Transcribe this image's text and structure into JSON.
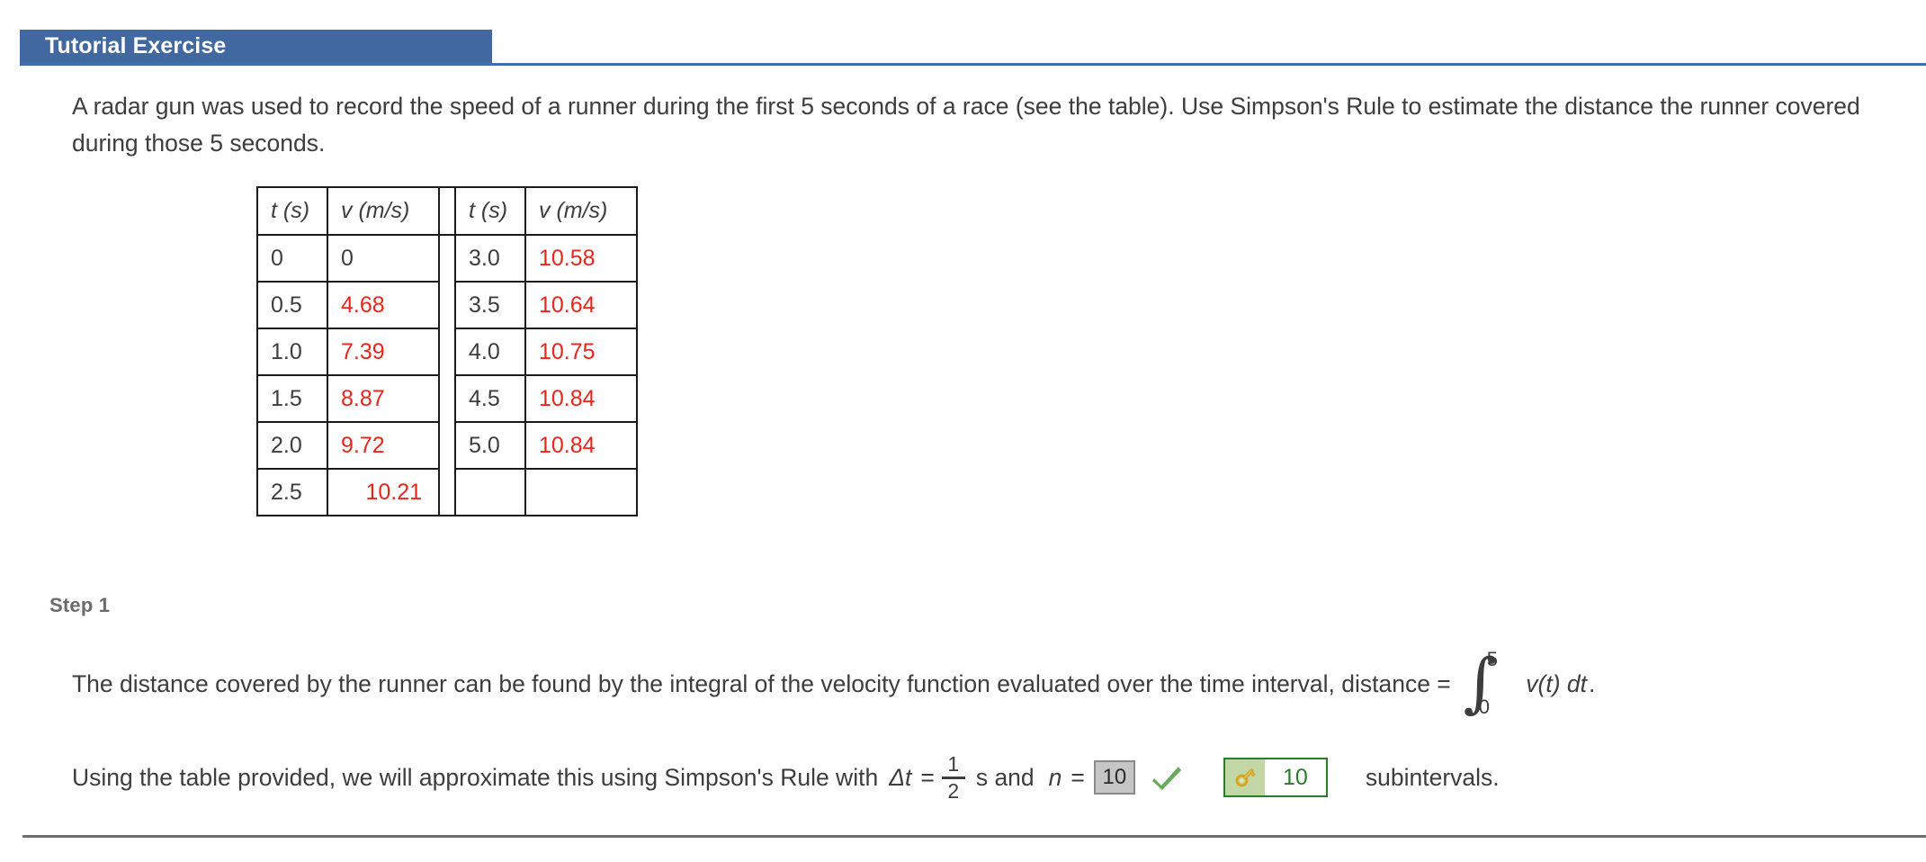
{
  "header": {
    "tab_label": "Tutorial Exercise",
    "tab_color": "#41699f",
    "rule_color": "#3f6fab"
  },
  "problem": {
    "statement": "A radar gun was used to record the speed of a runner during the first 5 seconds of a race (see the table). Use Simpson's Rule to estimate the distance the runner covered during those 5 seconds."
  },
  "data_table": {
    "headers": {
      "t": "t (s)",
      "v": "v (m/s)"
    },
    "left": [
      {
        "t": "0",
        "v": "0",
        "v_color": "dark"
      },
      {
        "t": "0.5",
        "v": "4.68",
        "v_color": "red"
      },
      {
        "t": "1.0",
        "v": "7.39",
        "v_color": "red"
      },
      {
        "t": "1.5",
        "v": "8.87",
        "v_color": "red"
      },
      {
        "t": "2.0",
        "v": "9.72",
        "v_color": "red"
      },
      {
        "t": "2.5",
        "v": "10.21",
        "v_color": "red"
      }
    ],
    "right": [
      {
        "t": "3.0",
        "v": "10.58",
        "v_color": "red"
      },
      {
        "t": "3.5",
        "v": "10.64",
        "v_color": "red"
      },
      {
        "t": "4.0",
        "v": "10.75",
        "v_color": "red"
      },
      {
        "t": "4.5",
        "v": "10.84",
        "v_color": "red"
      },
      {
        "t": "5.0",
        "v": "10.84",
        "v_color": "red"
      },
      {
        "t": "",
        "v": "",
        "v_color": "dark"
      }
    ],
    "value_color": "#e8261c",
    "border_color": "#1a1a1a"
  },
  "step1": {
    "label": "Step 1",
    "sentence_a": "The distance covered by the runner can be found by the integral of the velocity function evaluated over the time interval,  distance =",
    "integral": {
      "upper_limit": "5",
      "lower_limit": "0",
      "integrand": "v(t) dt",
      "trailing": "."
    },
    "sentence_b": "Using the table provided, we will approximate this using Simpson's Rule with",
    "delta_t_label": "Δt",
    "equals": "=",
    "fraction": {
      "numerator": "1",
      "denominator": "2"
    },
    "unit": "s and",
    "n_label": "n",
    "n_equals": "=",
    "answer_value": "10",
    "check_icon": "green-check-icon",
    "check_color": "#6aaa5e",
    "answer_key": {
      "icon": "key-icon",
      "value": "10",
      "border_color": "#2c7a2c",
      "icon_bg": "#c3d6a5",
      "text_color": "#2c7a2c"
    },
    "subintervals_label": "subintervals."
  }
}
